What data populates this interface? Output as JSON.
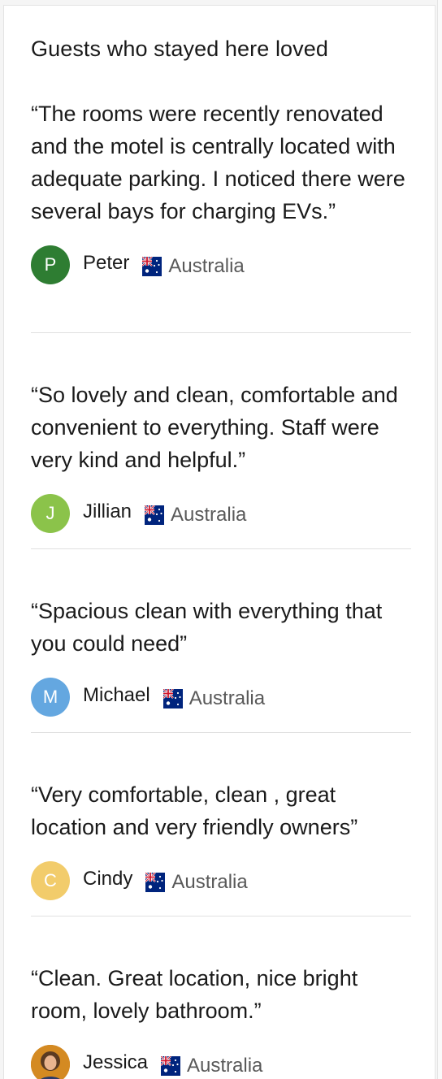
{
  "section": {
    "title": "Guests who stayed here loved"
  },
  "reviews": [
    {
      "quote": "“The rooms were recently renovated and the motel is centrally located with adequate parking. I noticed there were several bays for charging EVs.”",
      "initial": "P",
      "name": "Peter",
      "country": "Australia",
      "avatar_color": "#2e7d32"
    },
    {
      "quote": "“So lovely and clean, comfortable and convenient to everything. Staff were very kind and helpful.”",
      "initial": "J",
      "name": "Jillian",
      "country": "Australia",
      "avatar_color": "#8bc34a"
    },
    {
      "quote": "“Spacious clean with everything that you could need”",
      "initial": "M",
      "name": "Michael",
      "country": "Australia",
      "avatar_color": "#64a7e0"
    },
    {
      "quote": "“Very comfortable, clean , great location and very friendly owners”",
      "initial": "C",
      "name": "Cindy",
      "country": "Australia",
      "avatar_color": "#f2cc6b"
    },
    {
      "quote": "“Clean. Great location, nice bright room, lovely bathroom.”",
      "initial": "",
      "name": "Jessica",
      "country": "Australia",
      "avatar_color": "#e08a1e"
    }
  ],
  "icons": {
    "flag": "australia-flag-icon",
    "photo_avatar": "profile-photo-avatar"
  }
}
